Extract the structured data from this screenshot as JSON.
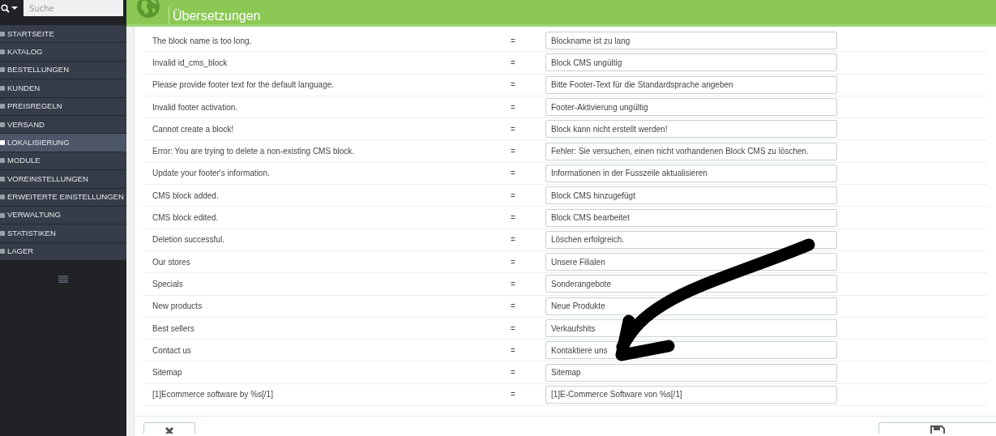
{
  "search": {
    "placeholder": "Suche"
  },
  "sidebar": {
    "items": [
      {
        "label": "STARTSEITE",
        "selected": false
      },
      {
        "label": "KATALOG",
        "selected": false
      },
      {
        "label": "BESTELLUNGEN",
        "selected": false
      },
      {
        "label": "KUNDEN",
        "selected": false
      },
      {
        "label": "PREISREGELN",
        "selected": false
      },
      {
        "label": "VERSAND",
        "selected": false
      },
      {
        "label": "LOKALISIERUNG",
        "selected": true
      },
      {
        "label": "MODULE",
        "selected": false
      },
      {
        "label": "VOREINSTELLUNGEN",
        "selected": false
      },
      {
        "label": "ERWEITERTE EINSTELLUNGEN",
        "selected": false
      },
      {
        "label": "VERWALTUNG",
        "selected": false
      },
      {
        "label": "STATISTIKEN",
        "selected": false
      },
      {
        "label": "LAGER",
        "selected": false
      }
    ]
  },
  "header": {
    "title": "Übersetzungen"
  },
  "translations": [
    {
      "source": "The block name is too long.",
      "separator": "=",
      "value": "Blockname ist zu lang"
    },
    {
      "source": "Invalid id_cms_block",
      "separator": "=",
      "value": "Block CMS ungültig"
    },
    {
      "source": "Please provide footer text for the default language.",
      "separator": "=",
      "value": "Bitte Footer-Text für die Standardsprache angeben"
    },
    {
      "source": "Invalid footer activation.",
      "separator": "=",
      "value": "Footer-Aktivierung ungültig"
    },
    {
      "source": "Cannot create a block!",
      "separator": "=",
      "value": "Block kann nicht erstellt werden!"
    },
    {
      "source": "Error: You are trying to delete a non-existing CMS block.",
      "separator": "=",
      "value": "Fehler: Sie versuchen, einen nicht vorhandenen Block CMS zu löschen."
    },
    {
      "source": "Update your footer's information.",
      "separator": "=",
      "value": "Informationen in der Fusszeile aktualisieren"
    },
    {
      "source": "CMS block added.",
      "separator": "=",
      "value": "Block CMS hinzugefügt"
    },
    {
      "source": "CMS block edited.",
      "separator": "=",
      "value": "Block CMS bearbeitet"
    },
    {
      "source": "Deletion successful.",
      "separator": "=",
      "value": "Löschen erfolgreich."
    },
    {
      "source": "Our stores",
      "separator": "=",
      "value": "Unsere Filialen"
    },
    {
      "source": "Specials",
      "separator": "=",
      "value": "Sonderangebote"
    },
    {
      "source": "New products",
      "separator": "=",
      "value": "Neue Produkte"
    },
    {
      "source": "Best sellers",
      "separator": "=",
      "value": "Verkaufshits"
    },
    {
      "source": "Contact us",
      "separator": "=",
      "value": "Kontaktiere uns"
    },
    {
      "source": "Sitemap",
      "separator": "=",
      "value": "Sitemap"
    },
    {
      "source": "[1]Ecommerce software by %s[/1]",
      "separator": "=",
      "value": "[1]E-Commerce Software von %s[/1]"
    }
  ]
}
